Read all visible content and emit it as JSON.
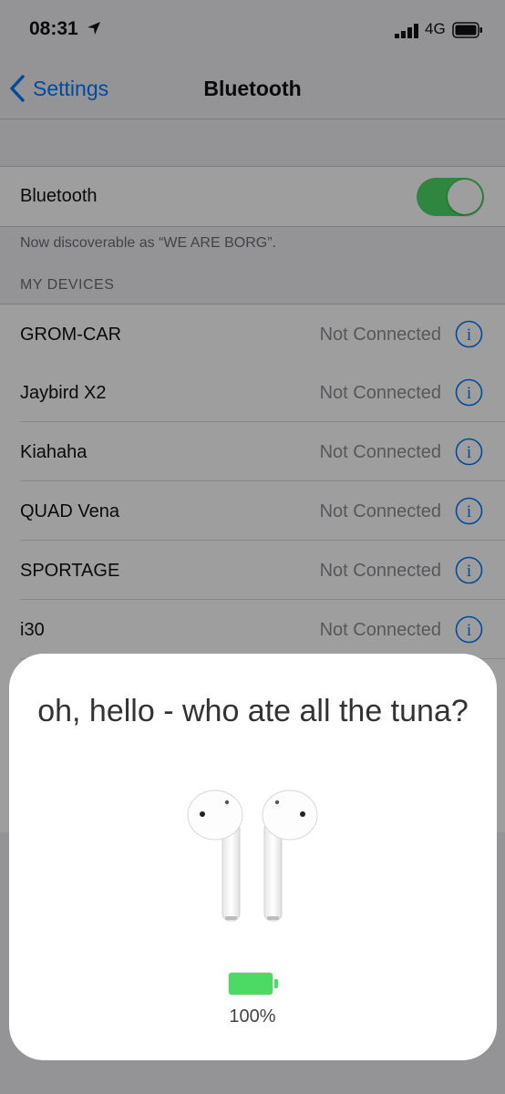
{
  "status_bar": {
    "time": "08:31",
    "network": "4G"
  },
  "nav": {
    "back_label": "Settings",
    "title": "Bluetooth"
  },
  "bluetooth": {
    "label": "Bluetooth",
    "enabled": true,
    "discoverable_note": "Now discoverable as “WE ARE BORG”."
  },
  "my_devices": {
    "header": "MY DEVICES",
    "items": [
      {
        "name": "GROM-CAR",
        "status": "Not Connected"
      },
      {
        "name": "Jaybird X2",
        "status": "Not Connected"
      },
      {
        "name": "Kiahaha",
        "status": "Not Connected"
      },
      {
        "name": "QUAD Vena",
        "status": "Not Connected"
      },
      {
        "name": "SPORTAGE",
        "status": "Not Connected"
      },
      {
        "name": "i30",
        "status": "Not Connected"
      }
    ]
  },
  "popup": {
    "title": "oh, hello - who ate all the tuna?",
    "battery_percent_label": "100%",
    "battery_level": 1.0
  },
  "colors": {
    "accent": "#007aff",
    "toggle_on": "#4cd964",
    "battery_green": "#4cd964"
  },
  "icons": [
    "location-arrow-icon",
    "signal-icon",
    "battery-icon",
    "chevron-left-icon",
    "info-icon",
    "airpods-icon",
    "airpods-battery-icon"
  ]
}
